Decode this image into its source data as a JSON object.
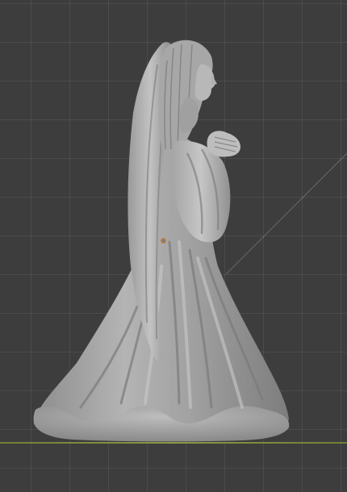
{
  "viewport": {
    "background": "#3d3d3d",
    "grid_color": "#4a4a4a",
    "ground_axis_color": "#7a8a3c",
    "origin_color": "#e07c1a"
  },
  "object": {
    "name_icon": "angel-sculpture",
    "base_color": "#a9a9a9",
    "shadow_color": "#6e6e6e",
    "highlight_color": "#cfcfcf"
  }
}
